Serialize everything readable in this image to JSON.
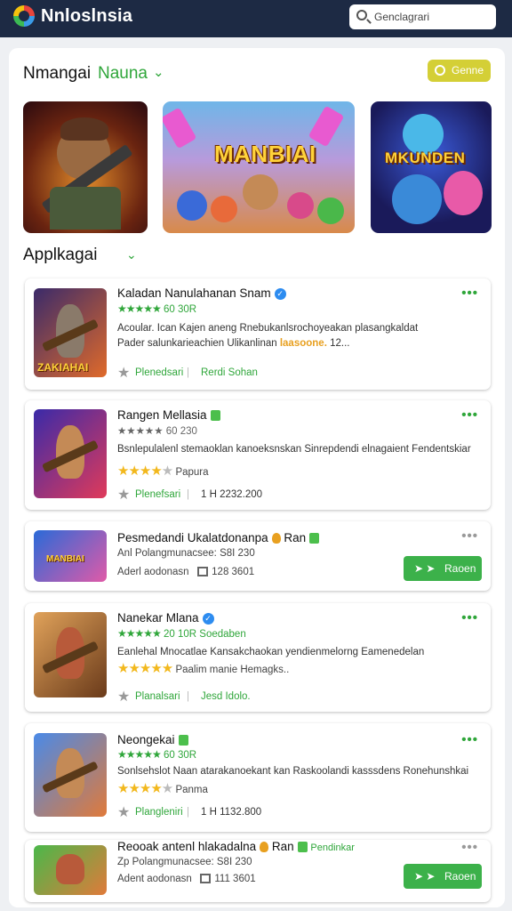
{
  "header": {
    "brand": "Nnloslnsia",
    "search_placeholder": "Genclagrari"
  },
  "featured": {
    "title": "Nmangai",
    "accent": "Nauna",
    "genre_button": "Genne",
    "banners": [
      {
        "title": ""
      },
      {
        "title": "MANBIAI"
      },
      {
        "title": "MKUNDEN"
      }
    ]
  },
  "apps_section": {
    "title": "Applkagai"
  },
  "apps": [
    {
      "name": "Kaladan Nanulahanan Snam",
      "rating": 5,
      "meta": "60 30R",
      "desc_line1": "Acoular. Ican Kajen aneng Rnebukanlsrochoyeakan plasangkaldat",
      "desc_line2_pre": "Pader salunkarieachien Ulikanlinan",
      "desc_line2_hl": "laasoone.",
      "desc_line2_post": "12...",
      "dl_a": "Plenedsari",
      "dl_b": "Rerdi Sohan",
      "thumb_label": "ZAKIAHAI"
    },
    {
      "name": "Rangen Mellasia",
      "meta": "★★★★★ 60 230",
      "desc": "Bsnlepulalenl stemaoklan kanoeksnskan Sinrepdendi elnagaient Fendentskiar",
      "gold_rating": 4,
      "sub": "Papura",
      "dl_a": "Plenefsari",
      "dl_c": "1 H 2232.200"
    },
    {
      "name": "Pesmedandi Ukalatdonanpa",
      "suffix": "Ran",
      "meta": "Anl Polangmunacsee: S8I 230",
      "info": "Aderl aodonasn",
      "size": "128 3601",
      "button": "Raoen"
    },
    {
      "name": "Nanekar Mlana",
      "rating": 5,
      "meta": "20 10R Soedaben",
      "desc": "Eanlehal Mnocatlae Kansakchaokan yendienmelorng Eamenedelan",
      "gold_rating": 5,
      "sub": "Paalim manie Hemagks..",
      "dl_a": "Planalsari",
      "dl_b": "Jesd Idolo."
    },
    {
      "name": "Neongekai",
      "rating": 5,
      "meta": "60 30R",
      "desc": "Sonlsehslot Naan atarakanoekant kan Raskoolandi kasssdens Ronehunshkai",
      "gold_rating": 4,
      "sub": "Panma",
      "dl_a": "Plangleniri",
      "dl_c": "1 H 1132.800"
    },
    {
      "name": "Reooak antenl hlakadalna",
      "suffix": "Ran",
      "suffix2": "Pendinkar",
      "meta": "Zp Polangmunacsee: S8I 230",
      "info": "Adent aodonasn",
      "size": "111 3601",
      "button": "Raoen"
    }
  ]
}
